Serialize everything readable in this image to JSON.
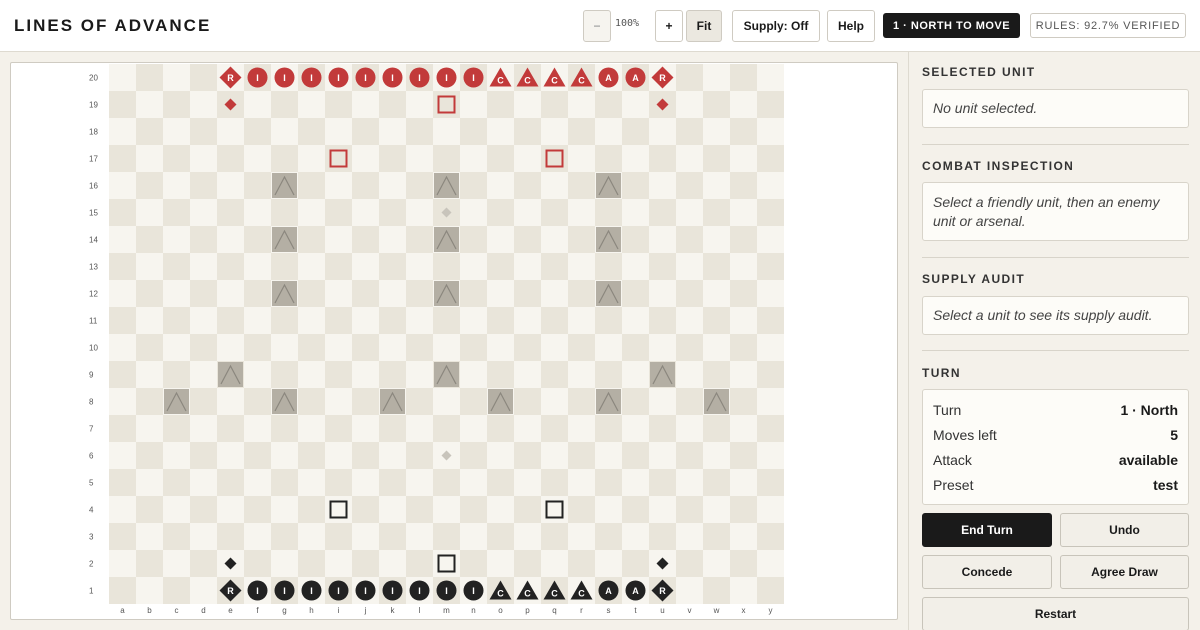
{
  "app": {
    "title": "LINES OF ADVANCE"
  },
  "toolbar": {
    "zoom_out_label": "−",
    "zoom_level": "100%",
    "zoom_in_label": "+",
    "fit_label": "Fit",
    "supply_label": "Supply: Off",
    "help_label": "Help",
    "move_status": "1 · NORTH TO MOVE",
    "rules_status": "RULES: 92.7% VERIFIED"
  },
  "board": {
    "files": [
      "a",
      "b",
      "c",
      "d",
      "e",
      "f",
      "g",
      "h",
      "i",
      "j",
      "k",
      "l",
      "m",
      "n",
      "o",
      "p",
      "q",
      "r",
      "s",
      "t",
      "u",
      "v",
      "w",
      "x",
      "y"
    ],
    "ranks": [
      20,
      19,
      18,
      17,
      16,
      15,
      14,
      13,
      12,
      11,
      10,
      9,
      8,
      7,
      6,
      5,
      4,
      3,
      2,
      1
    ],
    "colors": {
      "light": "#f7f5ef",
      "dark": "#e9e5da",
      "red": "#c23a3a",
      "black": "#222222",
      "mountain": "#b4afa4",
      "mountain_line": "#8b877e",
      "marker": "#c8c4bb"
    },
    "pieces": [
      {
        "sq": "e20",
        "side": "south",
        "shape": "diamond",
        "label": "R"
      },
      {
        "sq": "f20",
        "side": "south",
        "shape": "circle",
        "label": "I"
      },
      {
        "sq": "g20",
        "side": "south",
        "shape": "circle",
        "label": "I"
      },
      {
        "sq": "h20",
        "side": "south",
        "shape": "circle",
        "label": "I"
      },
      {
        "sq": "i20",
        "side": "south",
        "shape": "circle",
        "label": "I"
      },
      {
        "sq": "j20",
        "side": "south",
        "shape": "circle",
        "label": "I"
      },
      {
        "sq": "k20",
        "side": "south",
        "shape": "circle",
        "label": "I"
      },
      {
        "sq": "l20",
        "side": "south",
        "shape": "circle",
        "label": "I"
      },
      {
        "sq": "m20",
        "side": "south",
        "shape": "circle",
        "label": "I"
      },
      {
        "sq": "n20",
        "side": "south",
        "shape": "circle",
        "label": "I"
      },
      {
        "sq": "o20",
        "side": "south",
        "shape": "triangle",
        "label": "C"
      },
      {
        "sq": "p20",
        "side": "south",
        "shape": "triangle",
        "label": "C"
      },
      {
        "sq": "q20",
        "side": "south",
        "shape": "triangle",
        "label": "C"
      },
      {
        "sq": "r20",
        "side": "south",
        "shape": "triangle",
        "label": "C"
      },
      {
        "sq": "s20",
        "side": "south",
        "shape": "circle",
        "label": "A"
      },
      {
        "sq": "t20",
        "side": "south",
        "shape": "circle",
        "label": "A"
      },
      {
        "sq": "u20",
        "side": "south",
        "shape": "diamond",
        "label": "R"
      },
      {
        "sq": "e19",
        "side": "south",
        "shape": "small-diamond",
        "label": ""
      },
      {
        "sq": "u19",
        "side": "south",
        "shape": "small-diamond",
        "label": ""
      },
      {
        "sq": "m19",
        "side": "south",
        "shape": "arsenal",
        "label": ""
      },
      {
        "sq": "i17",
        "side": "south",
        "shape": "arsenal",
        "label": ""
      },
      {
        "sq": "q17",
        "side": "south",
        "shape": "arsenal",
        "label": ""
      },
      {
        "sq": "e1",
        "side": "north",
        "shape": "diamond",
        "label": "R"
      },
      {
        "sq": "f1",
        "side": "north",
        "shape": "circle",
        "label": "I"
      },
      {
        "sq": "g1",
        "side": "north",
        "shape": "circle",
        "label": "I"
      },
      {
        "sq": "h1",
        "side": "north",
        "shape": "circle",
        "label": "I"
      },
      {
        "sq": "i1",
        "side": "north",
        "shape": "circle",
        "label": "I"
      },
      {
        "sq": "j1",
        "side": "north",
        "shape": "circle",
        "label": "I"
      },
      {
        "sq": "k1",
        "side": "north",
        "shape": "circle",
        "label": "I"
      },
      {
        "sq": "l1",
        "side": "north",
        "shape": "circle",
        "label": "I"
      },
      {
        "sq": "m1",
        "side": "north",
        "shape": "circle",
        "label": "I"
      },
      {
        "sq": "n1",
        "side": "north",
        "shape": "circle",
        "label": "I"
      },
      {
        "sq": "o1",
        "side": "north",
        "shape": "triangle",
        "label": "C"
      },
      {
        "sq": "p1",
        "side": "north",
        "shape": "triangle",
        "label": "C"
      },
      {
        "sq": "q1",
        "side": "north",
        "shape": "triangle",
        "label": "C"
      },
      {
        "sq": "r1",
        "side": "north",
        "shape": "triangle",
        "label": "C"
      },
      {
        "sq": "s1",
        "side": "north",
        "shape": "circle",
        "label": "A"
      },
      {
        "sq": "t1",
        "side": "north",
        "shape": "circle",
        "label": "A"
      },
      {
        "sq": "u1",
        "side": "north",
        "shape": "diamond",
        "label": "R"
      },
      {
        "sq": "e2",
        "side": "north",
        "shape": "small-diamond",
        "label": ""
      },
      {
        "sq": "u2",
        "side": "north",
        "shape": "small-diamond",
        "label": ""
      },
      {
        "sq": "m2",
        "side": "north",
        "shape": "arsenal",
        "label": ""
      },
      {
        "sq": "i4",
        "side": "north",
        "shape": "arsenal",
        "label": ""
      },
      {
        "sq": "q4",
        "side": "north",
        "shape": "arsenal",
        "label": ""
      }
    ],
    "mountains": [
      "g16",
      "m16",
      "s16",
      "g14",
      "m14",
      "s14",
      "g12",
      "m12",
      "s12",
      "e9",
      "m9",
      "u9",
      "c8",
      "g8",
      "k8",
      "o8",
      "s8",
      "w8"
    ],
    "markers": [
      "m15",
      "m6"
    ]
  },
  "sidebar": {
    "selected_unit": {
      "title": "SELECTED UNIT",
      "text": "No unit selected."
    },
    "combat": {
      "title": "COMBAT INSPECTION",
      "text": "Select a friendly unit, then an enemy unit or arsenal."
    },
    "supply": {
      "title": "SUPPLY AUDIT",
      "text": "Select a unit to see its supply audit."
    },
    "turn": {
      "title": "TURN",
      "rows": [
        {
          "label": "Turn",
          "value": "1 · North"
        },
        {
          "label": "Moves left",
          "value": "5"
        },
        {
          "label": "Attack",
          "value": "available"
        },
        {
          "label": "Preset",
          "value": "test"
        }
      ]
    },
    "actions": {
      "end_turn": "End Turn",
      "undo": "Undo",
      "concede": "Concede",
      "agree_draw": "Agree Draw",
      "restart": "Restart"
    }
  }
}
